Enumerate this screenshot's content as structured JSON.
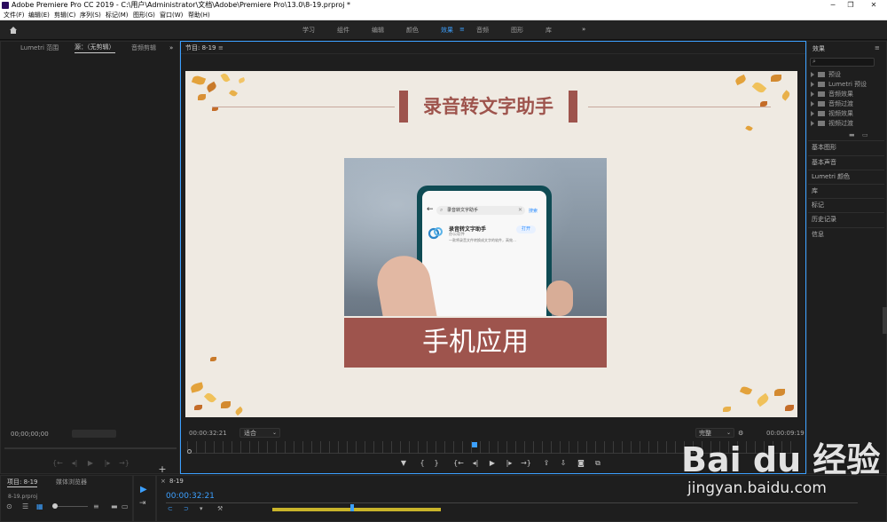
{
  "window": {
    "title": "Adobe Premiere Pro CC 2019 - C:\\用户\\Administrator\\文档\\Adobe\\Premiere Pro\\13.0\\8-19.prproj *"
  },
  "menu": {
    "items": [
      "文件(F)",
      "编辑(E)",
      "剪辑(C)",
      "序列(S)",
      "标记(M)",
      "图形(G)",
      "窗口(W)",
      "帮助(H)"
    ]
  },
  "workspaces": {
    "items": [
      "学习",
      "组件",
      "编辑",
      "颜色",
      "效果",
      "音频",
      "图形",
      "库"
    ],
    "active_index": 4,
    "more": "»"
  },
  "source_panel": {
    "tabs": [
      "Lumetri 范围",
      "源：（无剪辑）",
      "音频剪辑"
    ],
    "more": "»",
    "timecode": "00;00;00;00"
  },
  "program": {
    "tab": "节目: 8-19",
    "menu_glyph": "≡",
    "timecode": "00:00:32:21",
    "fit": "适合",
    "quality": "完整",
    "end_timecode": "00:00:09:19",
    "playhead_fraction": 0.47
  },
  "slide": {
    "title": "录音转文字助手",
    "caption": "手机应用",
    "phone": {
      "search_text": "录音转文字助手",
      "search_action": "搜索",
      "app_name": "录音转文字助手",
      "app_category": "办公软件",
      "app_desc": "一款将录音文件转换成文字的软件，高效…",
      "open_label": "打开"
    }
  },
  "effects_panel": {
    "title": "效果",
    "menu_glyph": "≡",
    "search_placeholder": "",
    "tree": [
      "预设",
      "Lumetri 预设",
      "音频效果",
      "音频过渡",
      "视频效果",
      "视频过渡"
    ],
    "sections": [
      "基本图形",
      "基本声音",
      "Lumetri 颜色",
      "库",
      "标记",
      "历史记录",
      "信息"
    ]
  },
  "project_panel": {
    "tabs": [
      "项目: 8-19",
      "媒体浏览器"
    ],
    "file": "8-19.prproj"
  },
  "timeline": {
    "tab": "8-19",
    "timecode": "00:00:32:21"
  },
  "watermark": {
    "brand": "Bai du 经验",
    "url": "jingyan.baidu.com"
  },
  "colors": {
    "accent_blue": "#3ca0ff",
    "slide_brown": "#9e544d",
    "slide_background": "#efeae2"
  }
}
